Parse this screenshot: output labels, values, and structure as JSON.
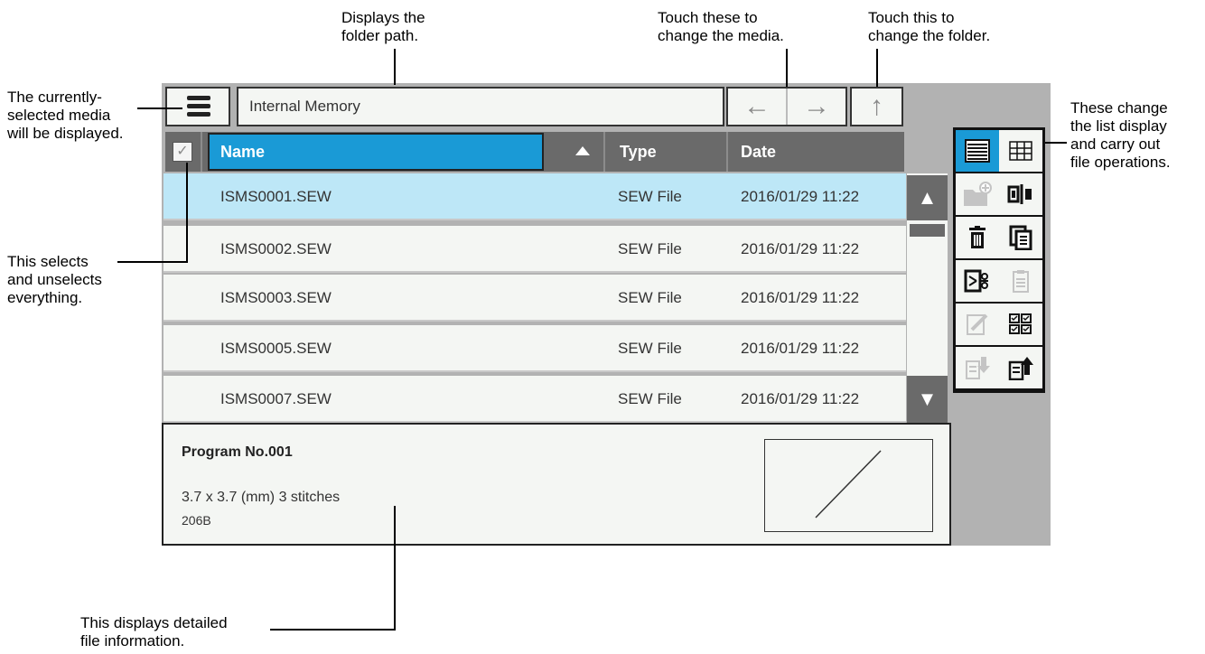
{
  "callouts": {
    "folder_path": "Displays the\nfolder path.",
    "media": "Touch these to\nchange the media.",
    "folder": "Touch this to\nchange the folder.",
    "current_media": "The currently-\nselected media\nwill be displayed.",
    "list_display": "These change\nthe list display\nand carry out\nfile operations.",
    "select_all": "This selects\nand unselects\neverything.",
    "detail": "This displays detailed\nfile information."
  },
  "screen": {
    "path": "Internal Memory",
    "header": {
      "name": "Name",
      "type": "Type",
      "date": "Date"
    },
    "rows": [
      {
        "name": "ISMS0001.SEW",
        "type": "SEW File",
        "date": "2016/01/29 11:22",
        "selected": true
      },
      {
        "name": "ISMS0002.SEW",
        "type": "SEW File",
        "date": "2016/01/29 11:22",
        "selected": false
      },
      {
        "name": "ISMS0003.SEW",
        "type": "SEW File",
        "date": "2016/01/29 11:22",
        "selected": false
      },
      {
        "name": "ISMS0005.SEW",
        "type": "SEW File",
        "date": "2016/01/29 11:22",
        "selected": false
      },
      {
        "name": "ISMS0007.SEW",
        "type": "SEW File",
        "date": "2016/01/29 11:22",
        "selected": false
      }
    ],
    "detail": {
      "program": "Program No.001",
      "size": "3.7 x 3.7 (mm) 3 stitches",
      "filesize": "206B"
    },
    "icons": {
      "menu": "hamburger-icon",
      "back": "arrow-left-icon",
      "forward": "arrow-right-icon",
      "up": "arrow-up-icon",
      "sort": "triangle-up-icon",
      "scroll_up": "scroll-up-icon",
      "scroll_down": "scroll-down-icon",
      "tools": [
        "list-view-icon",
        "grid-view-icon",
        "new-folder-icon",
        "rename-icon",
        "delete-icon",
        "copy-icon",
        "cut-icon",
        "paste-icon",
        "edit-icon",
        "select-multiple-icon",
        "import-icon",
        "export-icon"
      ]
    },
    "colors": {
      "accent": "#1a9ad6",
      "selected_row": "#bde7f7",
      "header": "#6a6a6a",
      "panel": "#f4f6f3"
    }
  }
}
